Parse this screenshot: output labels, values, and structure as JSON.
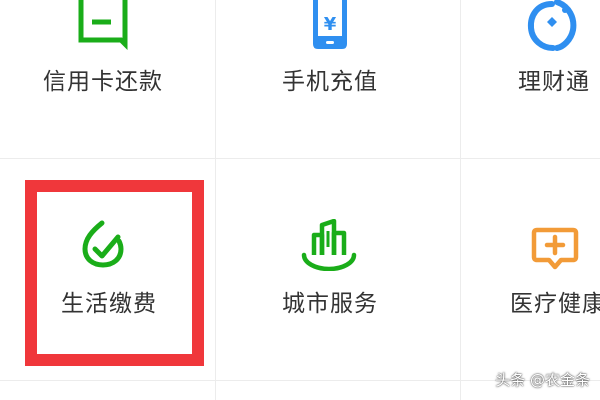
{
  "grid": {
    "row1": [
      {
        "label": "信用卡还款",
        "icon": "credit-card-icon",
        "color": "#1aad19"
      },
      {
        "label": "手机充值",
        "icon": "mobile-phone-icon",
        "color": "#2f8ff0"
      },
      {
        "label": "理财通",
        "icon": "wealth-icon",
        "color": "#2f8ff0"
      }
    ],
    "row2": [
      {
        "label": "生活缴费",
        "icon": "bill-payment-icon",
        "color": "#1aad19"
      },
      {
        "label": "城市服务",
        "icon": "city-service-icon",
        "color": "#1aad19"
      },
      {
        "label": "医疗健康",
        "icon": "medical-health-icon",
        "color": "#f29b38"
      }
    ]
  },
  "phone_icon_symbol": "¥",
  "highlight_color": "#f0373b",
  "watermark": "头条 @农金条"
}
